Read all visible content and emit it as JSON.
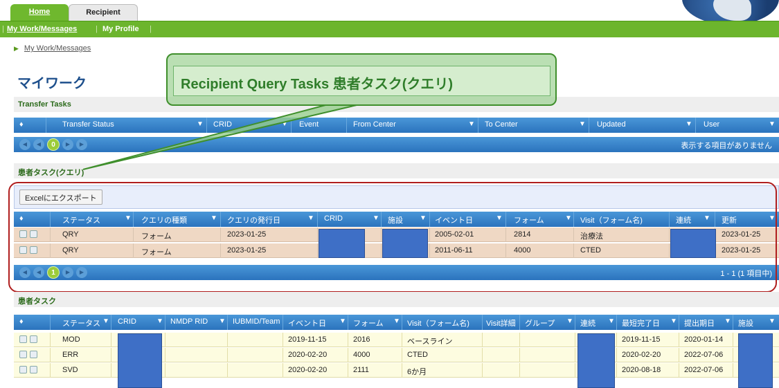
{
  "tabs": {
    "home": "Home",
    "recipient": "Recipient"
  },
  "nav": {
    "my_work": "My Work/Messages",
    "my_profile": "My Profile",
    "sep": "|"
  },
  "breadcrumb": {
    "item": "My Work/Messages"
  },
  "page_title": "マイワーク",
  "callout": "Recipient Query Tasks  患者タスク(クエリ)",
  "transfer": {
    "title": "Transfer Tasks",
    "columns": [
      "Transfer Status",
      "CRID",
      "Event",
      "From Center",
      "To Center",
      "Updated",
      "User"
    ],
    "page": "0",
    "empty_msg": "表示する項目がありません"
  },
  "query": {
    "title": "患者タスク(クエリ)",
    "export_label": "Excelにエクスポート",
    "columns": [
      "ステータス",
      "クエリの種類",
      "クエリの発行日",
      "CRID",
      "施設",
      "イベント日",
      "フォーム",
      "Visit（フォーム名)",
      "連続",
      "更新"
    ],
    "rows": [
      [
        "QRY",
        "フォーム",
        "2023-01-25",
        "",
        "",
        "2005-02-01",
        "2814",
        "治療法",
        "",
        "2023-01-25"
      ],
      [
        "QRY",
        "フォーム",
        "2023-01-25",
        "",
        "",
        "2011-06-11",
        "4000",
        "CTED",
        "",
        "2023-01-25"
      ]
    ],
    "page": "1",
    "range": "1 - 1 (1 項目中)"
  },
  "patient": {
    "title": "患者タスク",
    "columns": [
      "ステータス",
      "CRID",
      "NMDP RID",
      "IUBMID/Team",
      "イベント日",
      "フォーム",
      "Visit（フォーム名)",
      "Visit詳細",
      "グループ",
      "連続",
      "最短完了日",
      "提出期日",
      "施設"
    ],
    "rows": [
      [
        "MOD",
        "",
        "",
        "",
        "2019-11-15",
        "2016",
        "ベースライン",
        "",
        "",
        "",
        "2019-11-15",
        "2020-01-14",
        ""
      ],
      [
        "ERR",
        "",
        "",
        "",
        "2020-02-20",
        "4000",
        "CTED",
        "",
        "",
        "",
        "2020-02-20",
        "2022-07-06",
        ""
      ],
      [
        "SVD",
        "",
        "",
        "",
        "2020-02-20",
        "2111",
        "6か月",
        "",
        "",
        "",
        "2020-08-18",
        "2022-07-06",
        ""
      ]
    ]
  },
  "icons": {
    "filter": "filter-icon",
    "edit": "edit-icon",
    "print": "print-icon",
    "first": "first-page-icon",
    "prev": "prev-page-icon",
    "next": "next-page-icon",
    "last": "last-page-icon"
  },
  "colors": {
    "nav_green": "#6cb52d",
    "grid_blue": "#2b73bd",
    "query_row": "#efd8c4",
    "task_row": "#fdfce0",
    "mask": "#3e6fc6",
    "outline": "#b01e1e"
  }
}
